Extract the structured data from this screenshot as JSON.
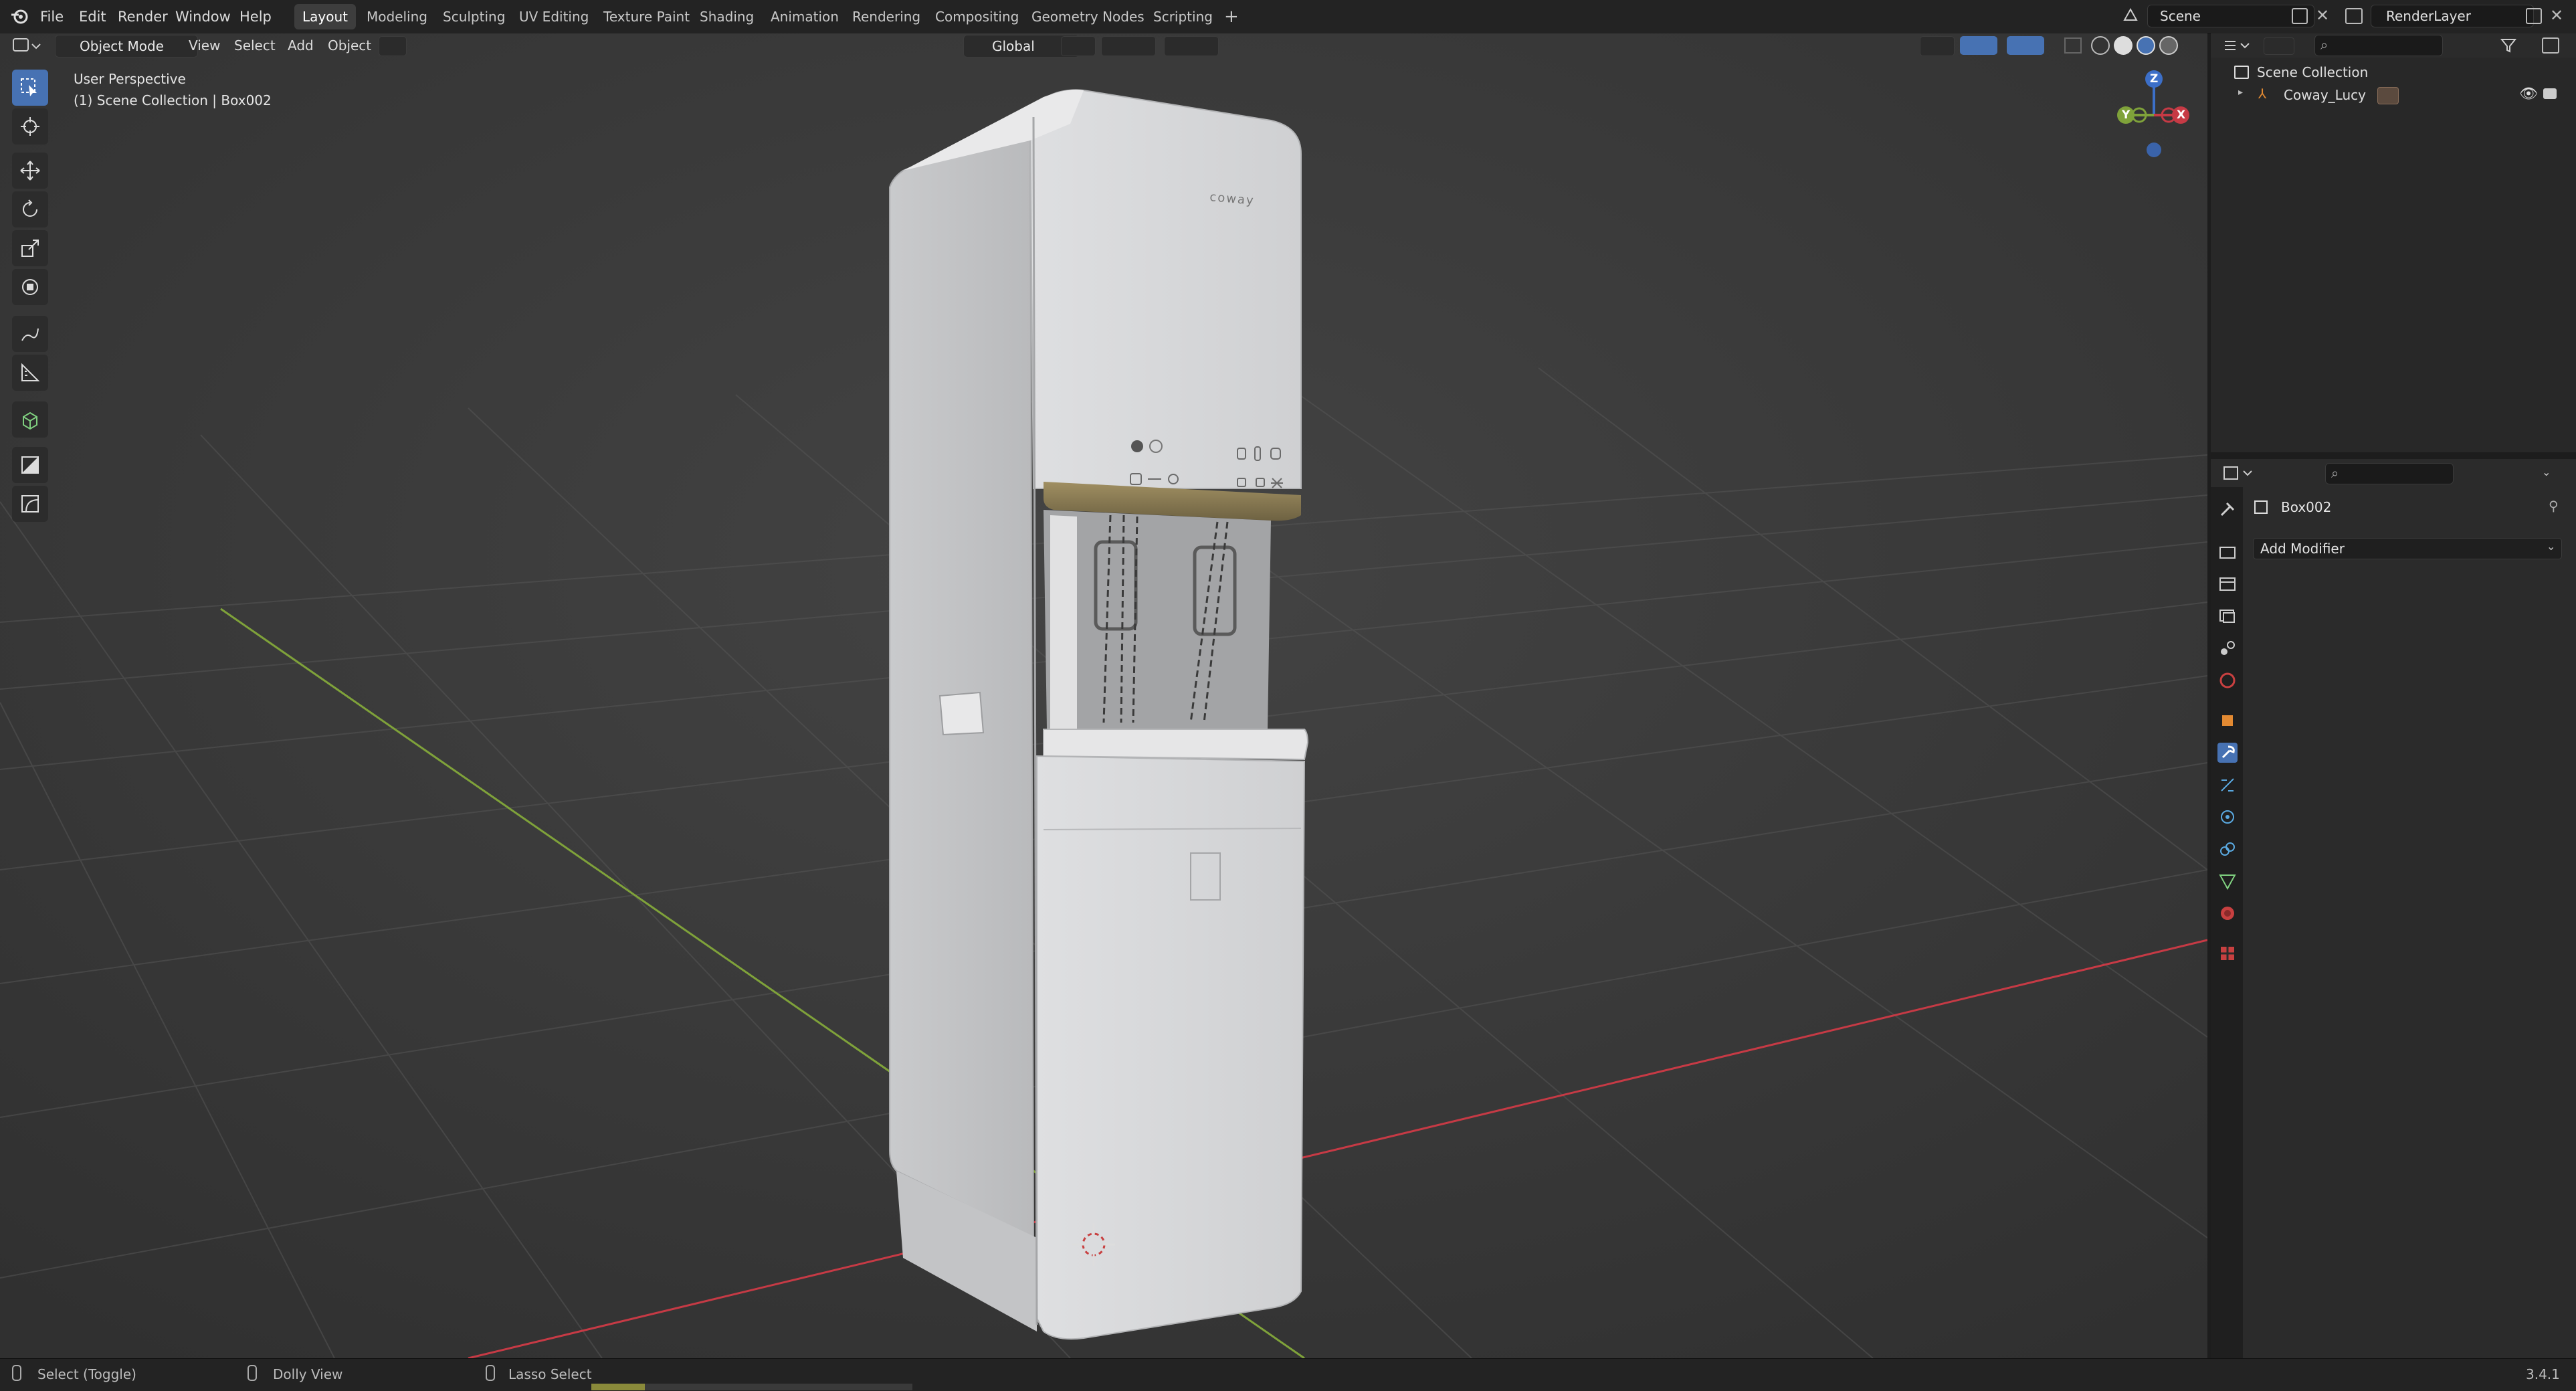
{
  "menus": [
    "File",
    "Edit",
    "Render",
    "Window",
    "Help"
  ],
  "workspace_tabs": [
    "Layout",
    "Modeling",
    "Sculpting",
    "UV Editing",
    "Texture Paint",
    "Shading",
    "Animation",
    "Rendering",
    "Compositing",
    "Geometry Nodes",
    "Scripting"
  ],
  "active_tab": "Layout",
  "add_tab_symbol": "+",
  "scene_name": "Scene",
  "render_layer": "RenderLayer",
  "viewport_header": {
    "mode": "Object Mode",
    "menus": [
      "View",
      "Select",
      "Add",
      "Object"
    ],
    "orientation": "Global"
  },
  "viewport_info": {
    "line1": "User Perspective",
    "line2": "(1) Scene Collection | Box002"
  },
  "gizmo": {
    "z": "Z",
    "y": "Y",
    "x": "X"
  },
  "model_brand": "coway",
  "outliner": {
    "root": "Scene Collection",
    "items": [
      "Coway_Lucy"
    ]
  },
  "properties": {
    "object_name": "Box002",
    "add_modifier": "Add Modifier"
  },
  "statusbar": {
    "left": "Select (Toggle)",
    "middle": "Dolly View",
    "right": "Lasso Select",
    "version": "3.4.1"
  },
  "colors": {
    "accent": "#4772b3",
    "x_axis": "#c63a45",
    "y_axis": "#7fa23a",
    "z_axis": "#3c6fc8",
    "body": "#d8d9db",
    "trim": "#8a7a55"
  }
}
